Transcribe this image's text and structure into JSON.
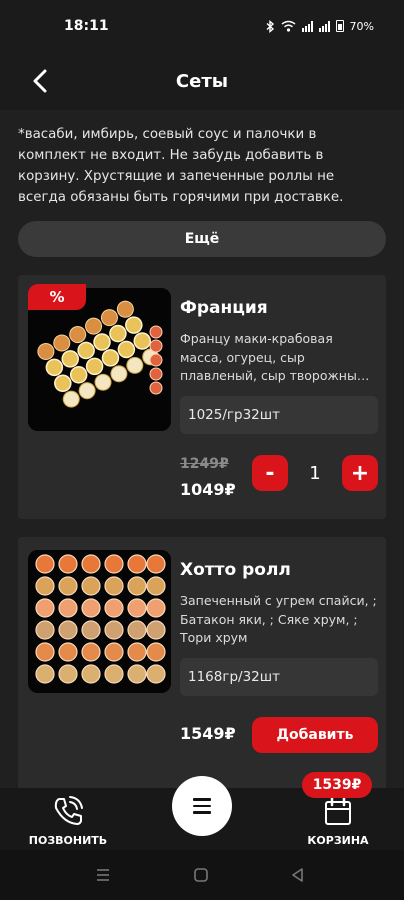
{
  "status_bar": {
    "time": "18:11",
    "battery": "70%"
  },
  "header": {
    "title": "Сеты"
  },
  "notice": "*васаби, имбирь, соевый соус и палочки в комплект не входит. Не забудь добавить в корзину. Хрустящие и запеченные роллы не всегда обязаны быть горячими при доставке.",
  "more_button": "Ещё",
  "products": [
    {
      "name": "Франция",
      "badge": "%",
      "description": "Францу маки-крабовая масса, огурец, сыр плавленый, сыр творожны…",
      "weight": "1025/гр32шт",
      "old_price": "1249₽",
      "price": "1049₽",
      "quantity": "1",
      "minus_label": "-",
      "plus_label": "+"
    },
    {
      "name": "Хотто ролл",
      "description": "Запеченный с угрем спайси, ; Батакон яки, ; Сяке хрум, ; Тори хрум",
      "weight": "1168гр/32шт",
      "price": "1549₽",
      "add_label": "Добавить"
    }
  ],
  "bottom_nav": {
    "call_label": "ПОЗВОНИТЬ",
    "cart_label": "КОРЗИНА",
    "cart_total": "1539₽"
  },
  "colors": {
    "accent": "#d9141b",
    "background": "#1b1b1b",
    "card": "#2b2b2b"
  },
  "icons": [
    "back-arrow-icon",
    "phone-icon",
    "menu-icon",
    "cart-icon",
    "bluetooth-icon",
    "wifi-icon",
    "signal-icon",
    "battery-icon"
  ]
}
